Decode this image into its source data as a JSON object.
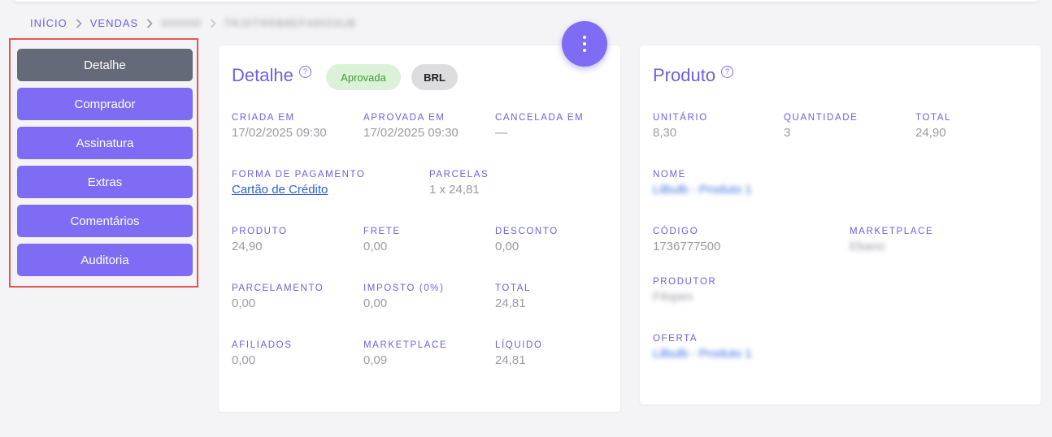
{
  "breadcrumb": {
    "home": "INÍCIO",
    "sales": "VENDAS",
    "blurred1": "000000",
    "blurred2": "TRJ0TRRB8EF49553UB"
  },
  "sidebar": {
    "items": [
      {
        "label": "Detalhe",
        "active": true
      },
      {
        "label": "Comprador"
      },
      {
        "label": "Assinatura"
      },
      {
        "label": "Extras"
      },
      {
        "label": "Comentários"
      },
      {
        "label": "Auditoria"
      }
    ]
  },
  "detail": {
    "title": "Detalhe",
    "help_icon": "?",
    "status_badge": "Aprovada",
    "currency_badge": "BRL",
    "created_label": "CRIADA EM",
    "created_value": "17/02/2025 09:30",
    "approved_label": "APROVADA EM",
    "approved_value": "17/02/2025 09:30",
    "cancelled_label": "CANCELADA EM",
    "cancelled_value": "—",
    "payment_label": "FORMA DE PAGAMENTO",
    "payment_value": "Cartão de Crédito",
    "installments_label": "PARCELAS",
    "installments_value": "1 x 24,81",
    "product_label": "PRODUTO",
    "product_value": "24,90",
    "shipping_label": "FRETE",
    "shipping_value": "0,00",
    "discount_label": "DESCONTO",
    "discount_value": "0,00",
    "installment_fee_label": "PARCELAMENTO",
    "installment_fee_value": "0,00",
    "tax_label": "IMPOSTO (0%)",
    "tax_value": "0,00",
    "total_label": "TOTAL",
    "total_value": "24,81",
    "affiliates_label": "AFILIADOS",
    "affiliates_value": "0,00",
    "marketplace_label": "MARKETPLACE",
    "marketplace_value": "0,09",
    "net_label": "LÍQUIDO",
    "net_value": "24,81"
  },
  "product": {
    "title": "Produto",
    "help_icon": "?",
    "unit_label": "UNITÁRIO",
    "unit_value": "8,30",
    "quantity_label": "QUANTIDADE",
    "quantity_value": "3",
    "total_label": "TOTAL",
    "total_value": "24,90",
    "name_label": "NOME",
    "name_value": "Lilbulb - Produto 1",
    "code_label": "CÓDIGO",
    "code_value": "1736777500",
    "marketplace_label": "MARKETPLACE",
    "marketplace_value": "Ebano",
    "producer_label": "PRODUTOR",
    "producer_value": "Filopen",
    "offer_label": "OFERTA",
    "offer_value": "Lilbulb - Produto 1"
  },
  "colors": {
    "accent": "#7e6cf5",
    "active_nav": "#646a78",
    "highlight_border": "#e5564f",
    "approved_bg": "#dcf2d8",
    "approved_text": "#3a9b2e"
  },
  "fab": {
    "icon": "more-vertical-icon"
  }
}
